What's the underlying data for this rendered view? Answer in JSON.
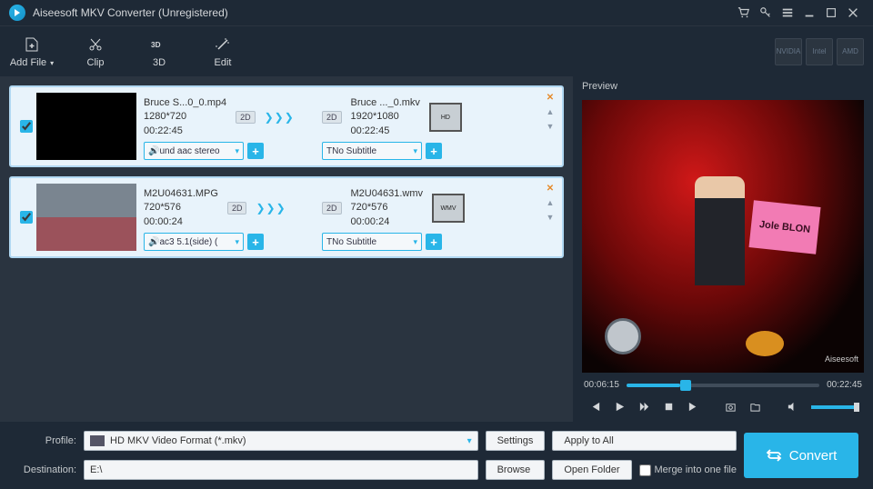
{
  "titlebar": {
    "title": "Aiseesoft MKV Converter (Unregistered)"
  },
  "toolbar": {
    "add_file": "Add File",
    "clip": "Clip",
    "three_d": "3D",
    "edit": "Edit",
    "hw": [
      "NVIDIA",
      "Intel",
      "AMD"
    ]
  },
  "files": [
    {
      "checked": true,
      "thumb_class": "",
      "src_name": "Bruce S...0_0.mp4",
      "src_res": "1280*720",
      "src_dur": "00:22:45",
      "dst_name": "Bruce ..._0.mkv",
      "dst_res": "1920*1080",
      "dst_dur": "00:22:45",
      "audio": "und aac stereo",
      "subtitle": "No Subtitle",
      "format_badge": "HD"
    },
    {
      "checked": true,
      "thumb_class": "photo",
      "src_name": "M2U04631.MPG",
      "src_res": "720*576",
      "src_dur": "00:00:24",
      "dst_name": "M2U04631.wmv",
      "dst_res": "720*576",
      "dst_dur": "00:00:24",
      "audio": "ac3 5.1(side) (",
      "subtitle": "No Subtitle",
      "format_badge": "WMV"
    }
  ],
  "preview": {
    "header": "Preview",
    "sign_text": "Jole BLON",
    "watermark": "Aiseesoft",
    "time_cur": "00:06:15",
    "time_total": "00:22:45"
  },
  "bottom": {
    "profile_label": "Profile:",
    "profile_value": "HD MKV Video Format (*.mkv)",
    "settings": "Settings",
    "apply_all": "Apply to All",
    "destination_label": "Destination:",
    "destination_value": "E:\\",
    "browse": "Browse",
    "open_folder": "Open Folder",
    "merge": "Merge into one file",
    "convert": "Convert"
  },
  "tag2d": "2D"
}
